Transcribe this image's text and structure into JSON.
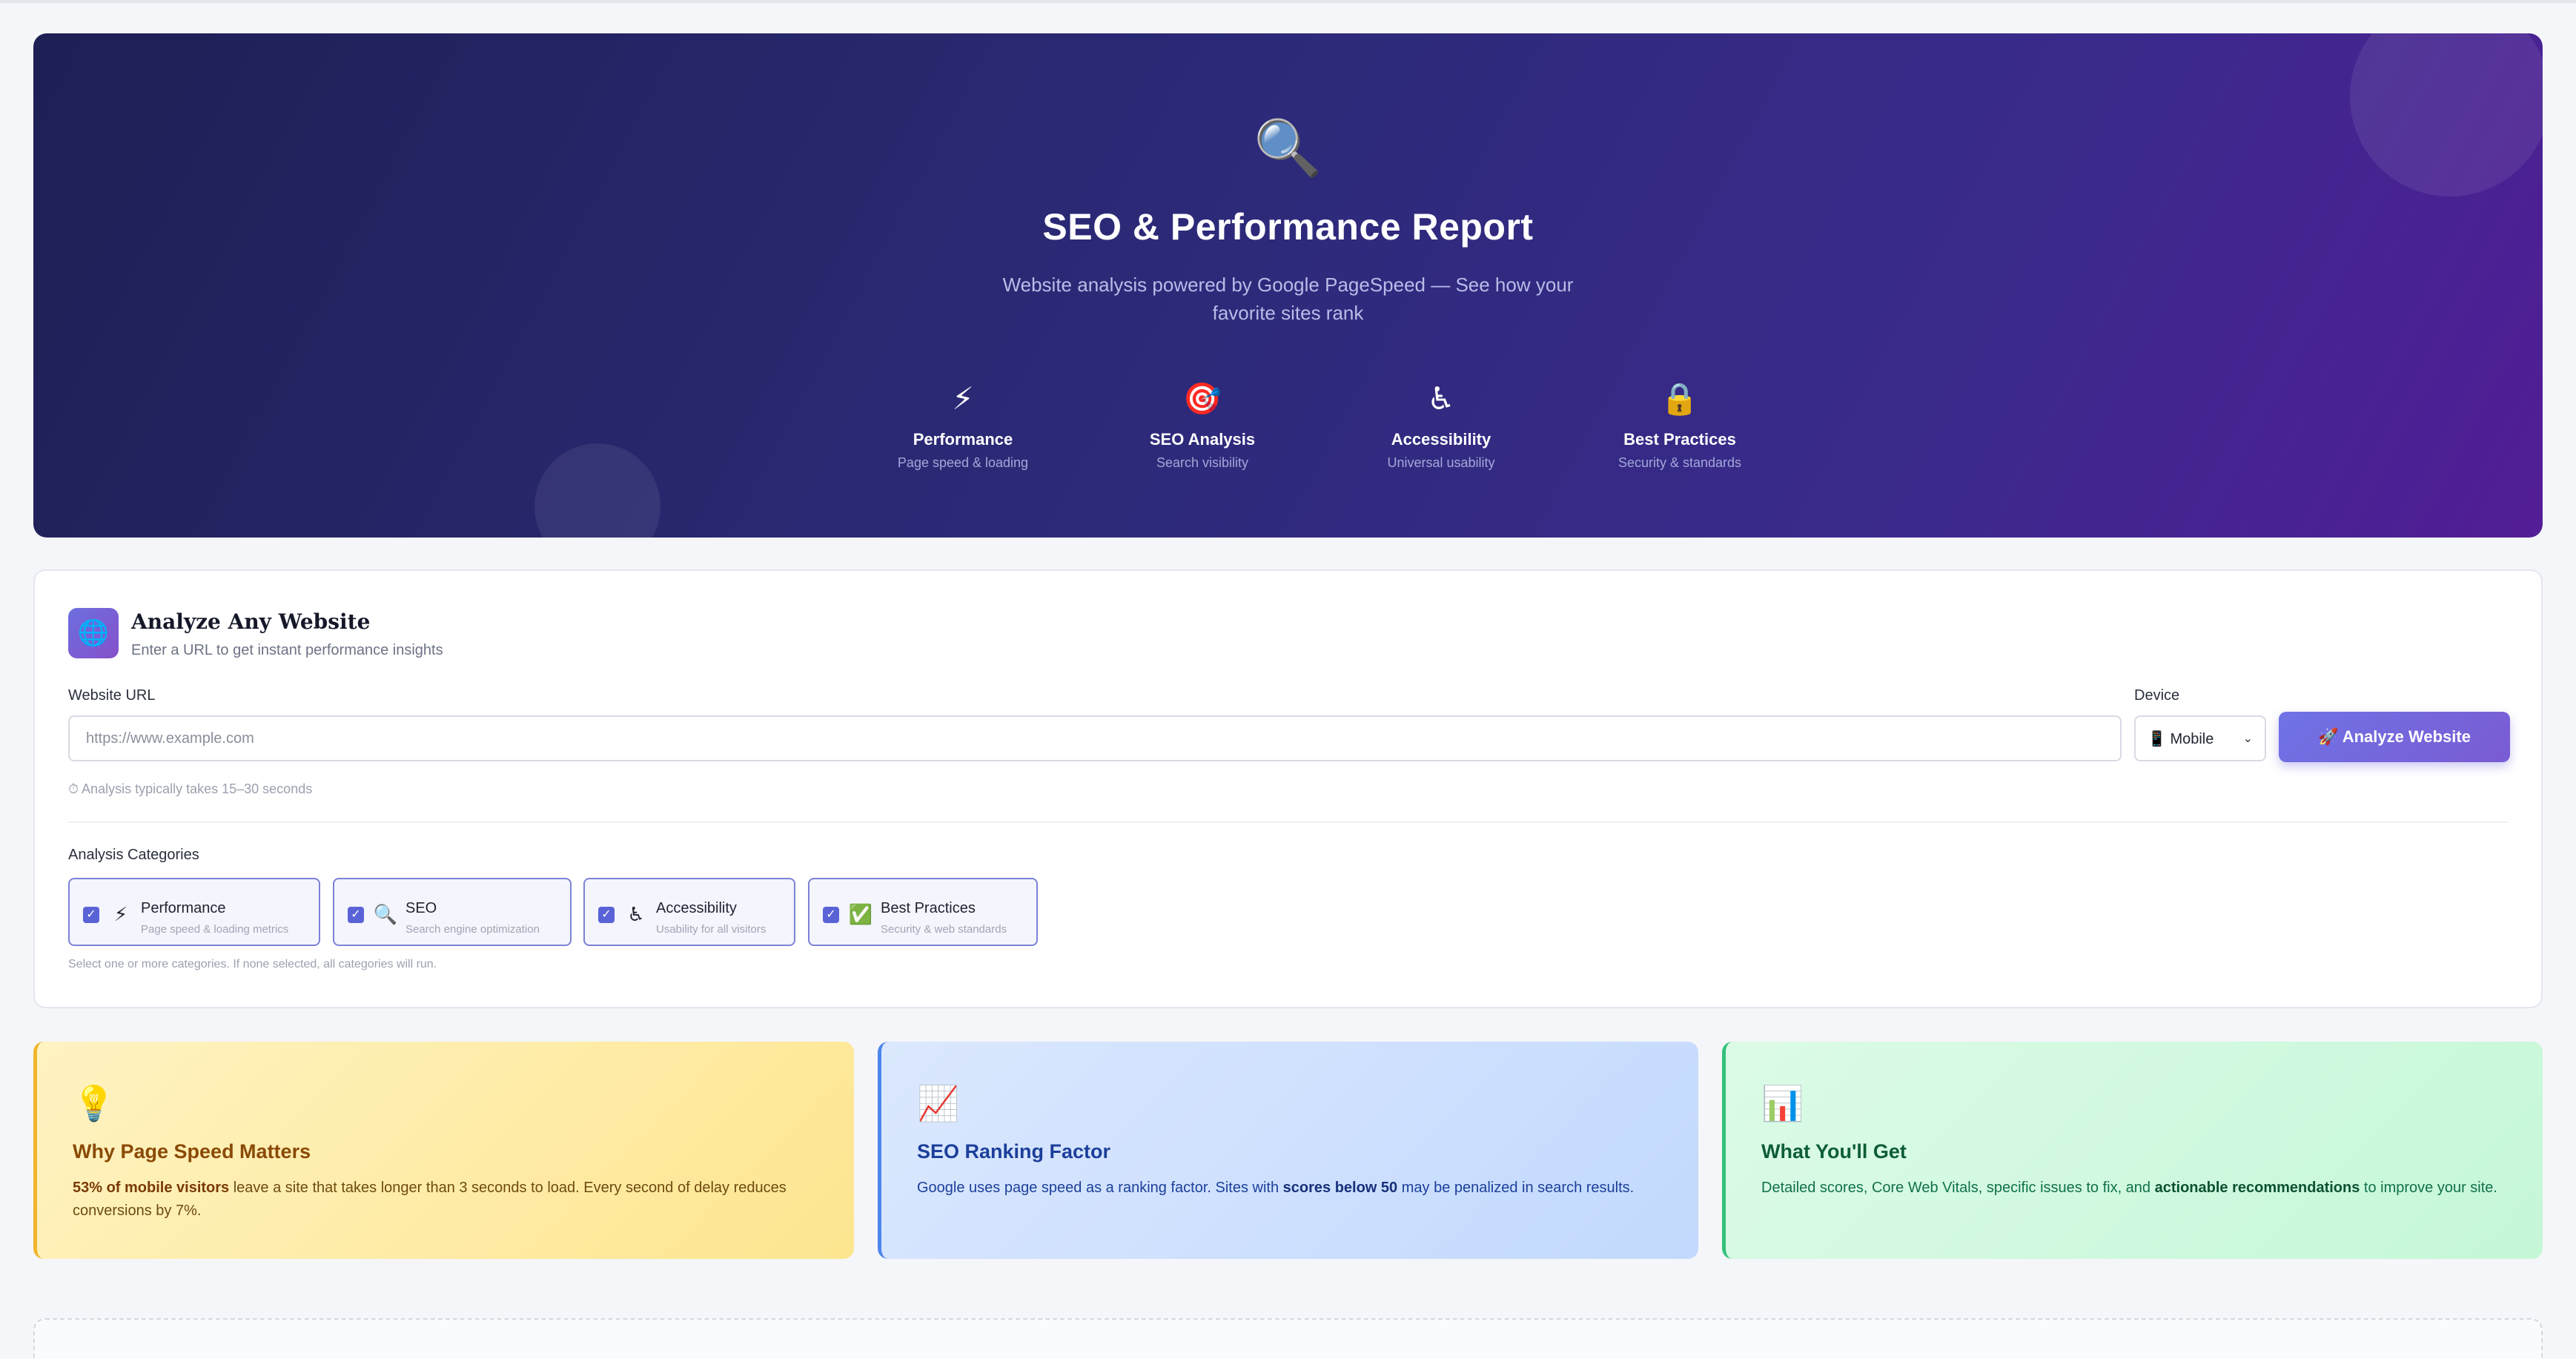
{
  "hero": {
    "icon": "🔍",
    "title": "SEO & Performance Report",
    "subtitle": "Website analysis powered by Google PageSpeed — See how your favorite sites rank",
    "features": [
      {
        "icon": "⚡",
        "icon_name": "lightning-icon",
        "title": "Performance",
        "subtitle": "Page speed & loading"
      },
      {
        "icon": "🎯",
        "icon_name": "target-icon",
        "title": "SEO Analysis",
        "subtitle": "Search visibility"
      },
      {
        "icon": "♿",
        "icon_name": "accessibility-icon",
        "title": "Accessibility",
        "subtitle": "Universal usability"
      },
      {
        "icon": "🔒",
        "icon_name": "lock-icon",
        "title": "Best Practices",
        "subtitle": "Security & standards"
      }
    ]
  },
  "analyze": {
    "icon": "🌐",
    "title": "Analyze Any Website",
    "subtitle": "Enter a URL to get instant performance insights",
    "url_label": "Website URL",
    "url_placeholder": "https://www.example.com",
    "url_value": "",
    "device_label": "Device",
    "device_value": "📱 Mobile",
    "button_label": "🚀 Analyze Website",
    "hint": "⏱ Analysis typically takes 15–30 seconds",
    "categories_label": "Analysis Categories",
    "categories": [
      {
        "icon": "⚡",
        "icon_name": "lightning-icon",
        "name": "Performance",
        "desc": "Page speed & loading metrics",
        "checked": true
      },
      {
        "icon": "🔍",
        "icon_name": "magnifier-icon",
        "name": "SEO",
        "desc": "Search engine optimization",
        "checked": true
      },
      {
        "icon": "♿",
        "icon_name": "accessibility-icon",
        "name": "Accessibility",
        "desc": "Usability for all visitors",
        "checked": true
      },
      {
        "icon": "✅",
        "icon_name": "check-mark-icon",
        "name": "Best Practices",
        "desc": "Security & web standards",
        "checked": true
      }
    ],
    "categories_note": "Select one or more categories. If none selected, all categories will run."
  },
  "info_cards": [
    {
      "icon": "💡",
      "icon_name": "lightbulb-icon",
      "title": "Why Page Speed Matters",
      "parts": [
        {
          "b": "53% of mobile visitors"
        },
        {
          "t": " leave a site that takes longer than 3 seconds to load. Every second of delay reduces conversions by 7%."
        }
      ]
    },
    {
      "icon": "📈",
      "icon_name": "trend-chart-icon",
      "title": "SEO Ranking Factor",
      "parts": [
        {
          "t": "Google uses page speed as a ranking factor. Sites with "
        },
        {
          "b": "scores below 50"
        },
        {
          "t": " may be penalized in search results."
        }
      ]
    },
    {
      "icon": "📊",
      "icon_name": "bar-chart-icon",
      "title": "What You'll Get",
      "parts": [
        {
          "t": "Detailed scores, Core Web Vitals, specific issues to fix, and "
        },
        {
          "b": "actionable recommendations"
        },
        {
          "t": " to improve your site."
        }
      ]
    }
  ],
  "colors": {
    "hero_start": "#1e1f54",
    "hero_end": "#521d96",
    "accent": "#6f73e6"
  }
}
